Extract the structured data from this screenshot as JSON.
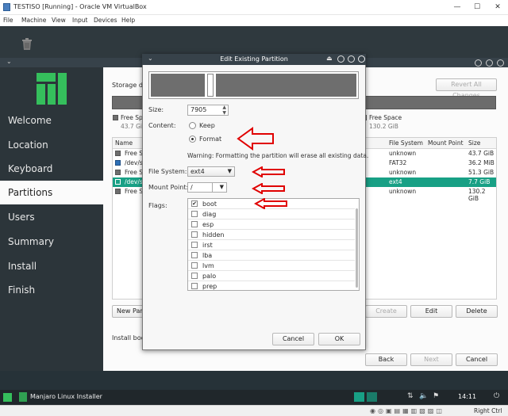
{
  "host": {
    "title": "TESTISO [Running] - Oracle VM VirtualBox",
    "menu": [
      "File",
      "Machine",
      "View",
      "Input",
      "Devices",
      "Help"
    ],
    "status_right": "Right Ctrl"
  },
  "sidebar": {
    "items": [
      {
        "label": "Welcome"
      },
      {
        "label": "Location"
      },
      {
        "label": "Keyboard"
      },
      {
        "label": "Partitions"
      },
      {
        "label": "Users"
      },
      {
        "label": "Summary"
      },
      {
        "label": "Install"
      },
      {
        "label": "Finish"
      }
    ],
    "active": "Partitions"
  },
  "main": {
    "storage_label": "Storage de",
    "revert_button": "Revert All Changes",
    "legend": [
      {
        "name": "Free Sp",
        "size": "43.7 Gi"
      },
      {
        "name": "Free Space",
        "size": "130.2 GiB"
      }
    ],
    "table": {
      "headers": [
        "Name",
        "File System",
        "Mount Point",
        "Size"
      ],
      "rows": [
        {
          "name": "Free S",
          "fs": "unknown",
          "mount": "",
          "size": "43.7 GiB",
          "selected": false
        },
        {
          "name": "/dev/s",
          "fs": "FAT32",
          "mount": "",
          "size": "36.2 MiB",
          "selected": false
        },
        {
          "name": "Free S",
          "fs": "unknown",
          "mount": "",
          "size": "51.3 GiB",
          "selected": false
        },
        {
          "name": "/dev/s",
          "fs": "ext4",
          "mount": "",
          "size": "7.7 GiB",
          "selected": true
        },
        {
          "name": "Free S",
          "fs": "unknown",
          "mount": "",
          "size": "130.2 GiB",
          "selected": false
        }
      ]
    },
    "new_partition_button": "New Part",
    "create_button": "Create",
    "edit_button": "Edit",
    "delete_button": "Delete",
    "bootloader_label": "Install boot",
    "back_button": "Back",
    "next_button": "Next",
    "cancel_button": "Cancel"
  },
  "dialog": {
    "title": "Edit Existing Partition",
    "size_label": "Size:",
    "size_value": "7905",
    "content_label": "Content:",
    "keep_label": "Keep",
    "format_label": "Format",
    "warning": "Warning: Formatting the partition will erase all existing data.",
    "fs_label": "File System:",
    "fs_value": "ext4",
    "mount_label": "Mount Point:",
    "mount_value": "/",
    "flags_label": "Flags:",
    "flags": [
      {
        "name": "boot",
        "checked": true
      },
      {
        "name": "diag",
        "checked": false
      },
      {
        "name": "esp",
        "checked": false
      },
      {
        "name": "hidden",
        "checked": false
      },
      {
        "name": "irst",
        "checked": false
      },
      {
        "name": "lba",
        "checked": false
      },
      {
        "name": "lvm",
        "checked": false
      },
      {
        "name": "palo",
        "checked": false
      },
      {
        "name": "prep",
        "checked": false
      }
    ],
    "cancel_button": "Cancel",
    "ok_button": "OK"
  },
  "taskbar": {
    "app_label": "Manjaro Linux Installer",
    "clock": "14:11"
  },
  "colors": {
    "accent": "#18a085",
    "sidebar_bg": "#2c353a",
    "annotation_red": "#e00000"
  }
}
